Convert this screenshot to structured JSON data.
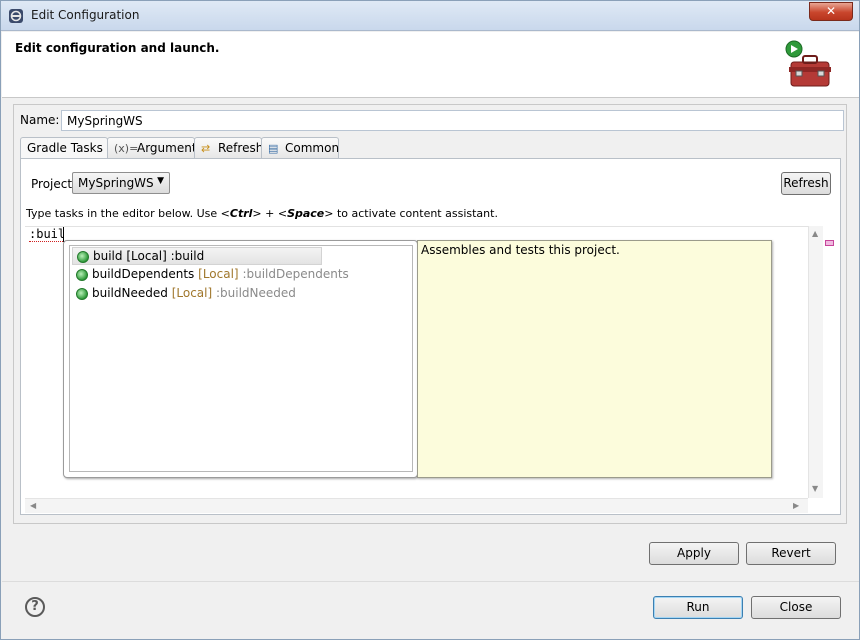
{
  "window": {
    "title": "Edit Configuration",
    "close_label": "✕"
  },
  "header": {
    "title": "Edit configuration and launch."
  },
  "name": {
    "label": "Name:",
    "value": "MySpringWS"
  },
  "tabs": [
    {
      "label": "Gradle Tasks",
      "icon": "none"
    },
    {
      "label": "Arguments",
      "icon": "variable-icon",
      "glyph": "(x)="
    },
    {
      "label": "Refresh",
      "icon": "refresh-icon",
      "glyph": "⇄"
    },
    {
      "label": "Common",
      "icon": "common-icon",
      "glyph": "▤"
    }
  ],
  "project": {
    "label": "Project",
    "selected": "MySpringWS",
    "refresh_label": "Refresh"
  },
  "hint": {
    "prefix": "Type tasks in the editor below. Use <",
    "key1": "Ctrl",
    "middle": "> + <",
    "key2": "Space",
    "suffix": "> to activate content assistant."
  },
  "editor": {
    "text": ":buil"
  },
  "proposals": [
    {
      "name": "build",
      "scope": "[Local]",
      "path": ":build",
      "selected": true
    },
    {
      "name": "buildDependents",
      "scope": "[Local]",
      "path": ":buildDependents",
      "selected": false
    },
    {
      "name": "buildNeeded",
      "scope": "[Local]",
      "path": ":buildNeeded",
      "selected": false
    }
  ],
  "doc": {
    "text": "Assembles and tests this project."
  },
  "buttons": {
    "apply": "Apply",
    "revert": "Revert",
    "run": "Run",
    "close": "Close",
    "help": "?"
  },
  "colors": {
    "doc_background": "#fcfcdc",
    "proposal_icon": "#2f9a3a",
    "scope_color": "#a0772c"
  }
}
